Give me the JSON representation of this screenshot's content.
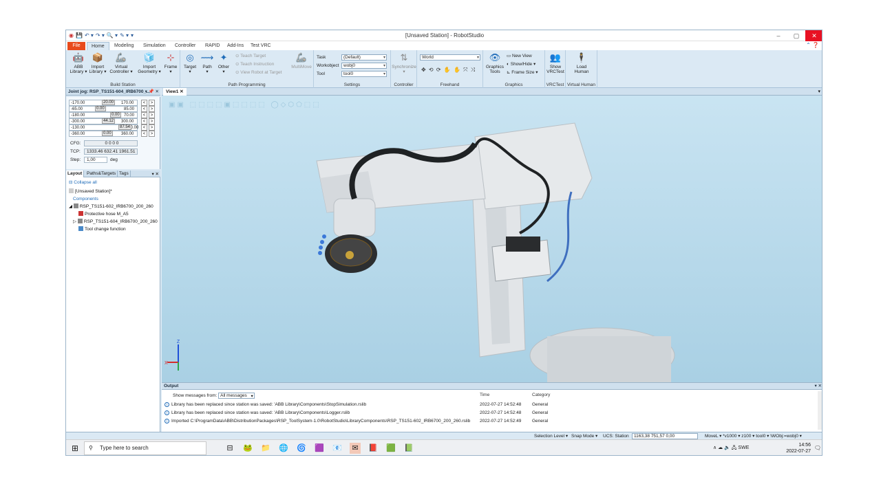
{
  "window": {
    "title": "[Unsaved Station] - RobotStudio",
    "min": "–",
    "max": "▢",
    "close": "✕"
  },
  "qat": [
    "💾",
    "↶ ▾",
    "↷ ▾",
    "🔍 ▾",
    "✎ ▾",
    "▾"
  ],
  "tabs": [
    "File",
    "Home",
    "Modeling",
    "Simulation",
    "Controller",
    "RAPID",
    "Add-Ins",
    "Test VRC"
  ],
  "active_tab": "Home",
  "ribbon": {
    "build_station": {
      "label": "Build Station",
      "buttons": [
        {
          "l1": "ABB",
          "l2": "Library ▾",
          "icon": "🤖"
        },
        {
          "l1": "Import",
          "l2": "Library ▾",
          "icon": "📦"
        },
        {
          "l1": "Virtual",
          "l2": "Controller ▾",
          "icon": "🦾"
        },
        {
          "l1": "Import",
          "l2": "Geometry ▾",
          "icon": "🧊"
        },
        {
          "l1": "Frame",
          "l2": "▾",
          "icon": "⊹"
        }
      ]
    },
    "path_programming": {
      "label": "Path Programming",
      "buttons": [
        {
          "l1": "Target",
          "l2": "▾",
          "icon": "◎"
        },
        {
          "l1": "Path",
          "l2": "▾",
          "icon": "⟿"
        },
        {
          "l1": "Other",
          "l2": "▾",
          "icon": "✦"
        }
      ],
      "small": [
        "Teach Target",
        "Teach Instruction",
        "View Robot at Target"
      ],
      "multimove": "MultiMove"
    },
    "settings": {
      "label": "Settings",
      "task_label": "Task",
      "task_value": "(Default)",
      "wobj_label": "Workobject",
      "wobj_value": "wobj0",
      "tool_label": "Tool",
      "tool_value": "tool0"
    },
    "controller": {
      "label": "Controller",
      "btn": "Synchronize",
      "btn2": "▾"
    },
    "freehand": {
      "label": "Freehand",
      "combo": "World",
      "tools": "✥ ⟲ ⟳ ✋ ✋ ⤧ ⤨"
    },
    "graphics": {
      "label": "Graphics",
      "btn1": "Graphics",
      "btn2": "Tools",
      "small": [
        "New View",
        "Show/Hide ▾",
        "Frame Size ▾"
      ]
    },
    "vrctest": {
      "label": "VRCTest",
      "l1": "Show",
      "l2": "VRCTest"
    },
    "virtual_human": {
      "label": "Virtual Human",
      "l1": "Load",
      "l2": "Human"
    }
  },
  "joint_jog": {
    "title": "Joint jog: RSP_TS151-604_IRB6700_...",
    "rows": [
      {
        "min": "-170.00",
        "val": "20.00",
        "max": "170.00"
      },
      {
        "min": "-65.00",
        "val": "0.00",
        "max": "85.00"
      },
      {
        "min": "-180.00",
        "val": "0.00",
        "max": "70.00"
      },
      {
        "min": "-300.00",
        "val": "44.12",
        "max": "300.00"
      },
      {
        "min": "-130.00",
        "val": "87.54",
        "max": "130.00"
      },
      {
        "min": "-360.00",
        "val": "0.00",
        "max": "360.00"
      }
    ],
    "cfg_label": "CFG:",
    "cfg_value": "0 0 0 0",
    "tcp_label": "TCP:",
    "tcp_value": "1333.46 632.41 1961.51",
    "step_label": "Step:",
    "step_value": "1,00",
    "step_unit": "deg"
  },
  "layout": {
    "tabs": [
      "Layout",
      "Paths&Targets",
      "Tags"
    ],
    "collapse": "Collapse all",
    "station": "[Unsaved Station]*",
    "components": "Components",
    "items": [
      "RSP_TS151-602_IRB6700_200_260",
      "Protective hose M_A5",
      "RSP_TS151-604_IRB6700_200_260",
      "Tool change function"
    ]
  },
  "view": {
    "tab": "View1",
    "axis_z": "Z",
    "axis_x": "X"
  },
  "output": {
    "title": "Output",
    "filter_label": "Show messages from:",
    "filter_value": "All messages",
    "col_time": "Time",
    "col_category": "Category",
    "rows": [
      {
        "msg": "Library has been replaced since station was saved: 'ABB Library\\Components\\StopSimulation.rslib",
        "time": "2022-07-27 14:52:48",
        "cat": "General"
      },
      {
        "msg": "Library has been replaced since station was saved: 'ABB Library\\Components\\Logger.rslib",
        "time": "2022-07-27 14:52:48",
        "cat": "General"
      },
      {
        "msg": "Imported C:\\ProgramData\\ABB\\DistributionPackages\\RSP_ToolSystem-1.0\\RobotStudio\\LibraryComponents\\RSP_TS151-602_IRB6700_200_260.rslib",
        "time": "2022-07-27 14:52:49",
        "cat": "General"
      }
    ]
  },
  "statusbar": {
    "selection": "Selection Level ▾",
    "snap": "Snap Mode ▾",
    "ucs_label": "UCS: Station",
    "ucs_value": "1163,38  751,57  0,00",
    "move": "MoveL ▾  *v1000 ▾  z100 ▾  tool0 ▾  \\WObj:=wobj0 ▾"
  },
  "taskbar": {
    "search": "Type here to search",
    "apps": [
      "⊟",
      "🐸",
      "📁",
      "🌐",
      "🌀",
      "🟪",
      "📧",
      "📕",
      "🟩",
      "📗"
    ],
    "tray_icons": "∧ ☁ 🔈 🖧 SWE",
    "time": "14:56",
    "date": "2022-07-27"
  },
  "colors": {
    "file_tab": "#e84a1b",
    "accent": "#1e6bb8",
    "close": "#e81123"
  }
}
